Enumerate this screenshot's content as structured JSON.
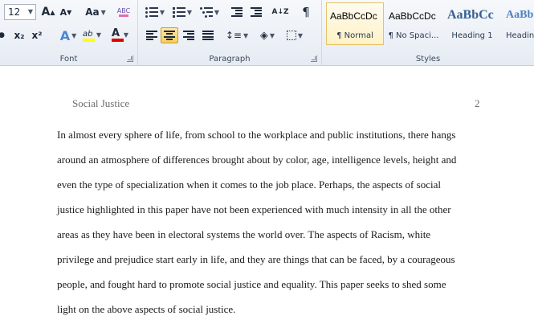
{
  "font_group": {
    "font_size": "12",
    "grow_font": "A",
    "shrink_font": "A",
    "change_case": "Aa",
    "clear_format": "ABC",
    "subscript": "x₂",
    "superscript": "x²",
    "text_effect": "A",
    "highlight": "ab",
    "font_color": "A",
    "label": "Font"
  },
  "paragraph_group": {
    "sort": "A↓Z",
    "pilcrow": "¶",
    "label": "Paragraph",
    "active_alignment": "center"
  },
  "styles_group": {
    "label": "Styles",
    "items": [
      {
        "sample": "AaBbCcDc",
        "name": "¶ Normal"
      },
      {
        "sample": "AaBbCcDc",
        "name": "¶ No Spaci..."
      },
      {
        "sample": "AaBbCc",
        "name": "Heading 1"
      },
      {
        "sample": "AaBb",
        "name": "Headin"
      }
    ]
  },
  "colors": {
    "highlight_bar": "#ffff00",
    "font_color_bar": "#e00000",
    "heading_blue": "#365f91"
  },
  "document": {
    "header_left": "Social Justice",
    "page_number": "2",
    "lines": [
      " In almost every sphere of life, from school to the workplace and public institutions, there hangs",
      "around an atmosphere of differences brought about by color, age, intelligence levels, height and",
      "even the type of specialization when it comes to the job place. Perhaps, the aspects of social",
      "justice highlighted in this paper have not been experienced with much intensity in all the other",
      "areas as they have been in electoral systems the world over. The aspects of Racism,  white",
      "privilege and prejudice start early in life, and they are things that can be faced, by a courageous",
      "people, and fought hard to promote social justice and equality. This paper seeks to shed some",
      "light on the above aspects of social justice."
    ]
  }
}
